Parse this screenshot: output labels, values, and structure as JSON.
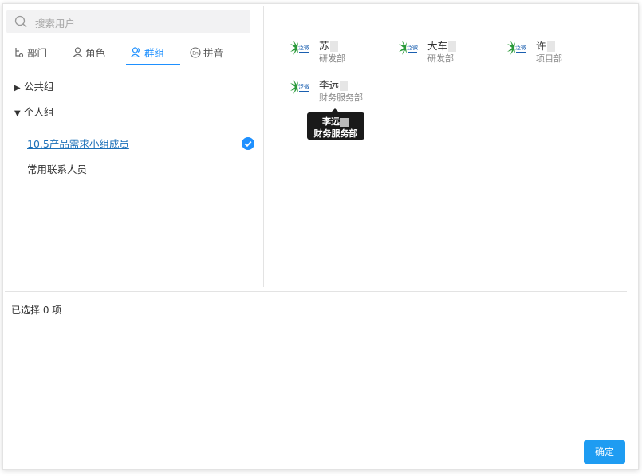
{
  "search": {
    "placeholder": "搜索用户"
  },
  "tabs": [
    {
      "label": "部门",
      "icon": "org-chart-icon",
      "active": false
    },
    {
      "label": "角色",
      "icon": "person-icon",
      "active": false
    },
    {
      "label": "群组",
      "icon": "group-icon",
      "active": true
    },
    {
      "label": "拼音",
      "icon": "en-icon",
      "active": false
    }
  ],
  "tree": {
    "public": {
      "label": "公共组",
      "expanded": false
    },
    "personal": {
      "label": "个人组",
      "expanded": true
    },
    "groups": [
      {
        "label": "10.5产品需求小组成员",
        "selected": true
      },
      {
        "label": "常用联系人员",
        "selected": false
      }
    ]
  },
  "users": [
    {
      "name": "苏",
      "dept": "研发部",
      "avatar": "company-logo-icon"
    },
    {
      "name": "大车",
      "dept": "研发部",
      "avatar": "company-logo-icon"
    },
    {
      "name": "许",
      "dept": "项目部",
      "avatar": "company-logo-icon"
    },
    {
      "name": "李远",
      "dept": "财务服务部",
      "avatar": "company-logo-icon"
    }
  ],
  "tooltip": {
    "name": "李远",
    "dept": "财务服务部"
  },
  "selection": {
    "summary": "已选择 0 项"
  },
  "footer": {
    "confirm_label": "确定"
  },
  "colors": {
    "accent": "#1e9cf2",
    "link": "#1a6fb8",
    "logo_green": "#2a9a3a"
  }
}
